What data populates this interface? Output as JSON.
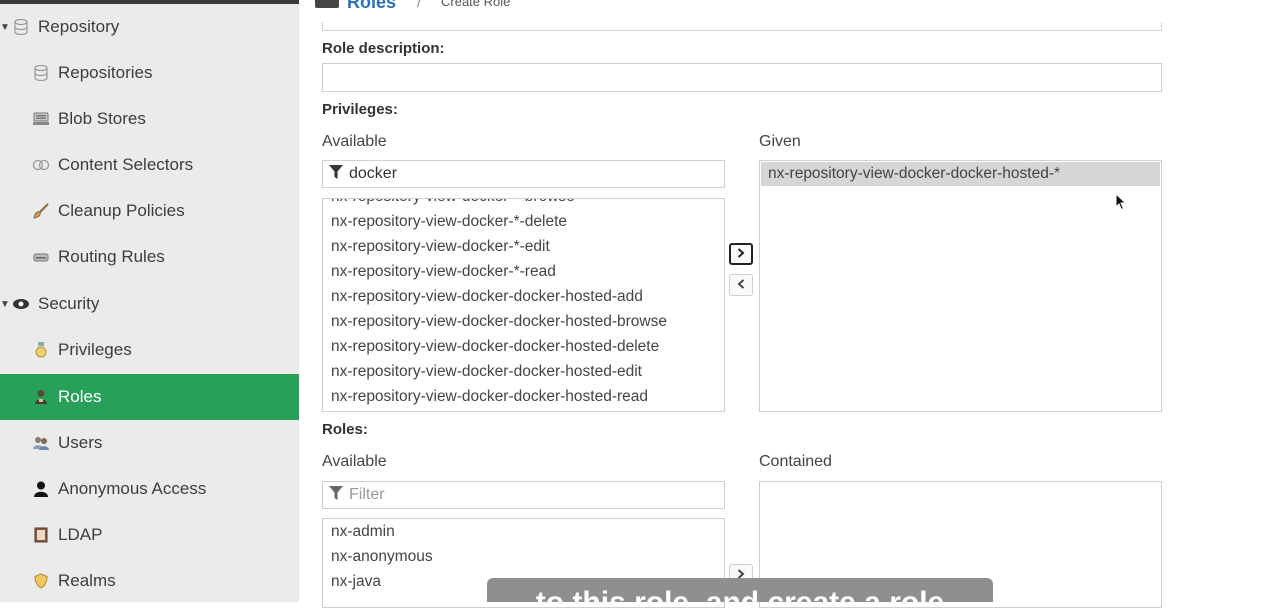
{
  "sidebar": {
    "repository_group": "Repository",
    "repository_items": [
      "Repositories",
      "Blob Stores",
      "Content Selectors",
      "Cleanup Policies",
      "Routing Rules"
    ],
    "security_group": "Security",
    "security_items": [
      "Privileges",
      "Roles",
      "Users",
      "Anonymous Access",
      "LDAP",
      "Realms"
    ],
    "active_item": "Roles",
    "icons": {
      "repository_group": "database-icon",
      "repositories": "database-icon",
      "blob_stores": "server-icon",
      "content_selectors": "selector-icon",
      "cleanup_policies": "brush-icon",
      "routing_rules": "router-icon",
      "security_group": "eye-icon",
      "privileges": "medal-icon",
      "roles": "role-badge-icon",
      "users": "users-icon",
      "anonymous_access": "person-icon",
      "ldap": "book-icon",
      "realms": "shield-icon"
    },
    "active_color": "#28a05a"
  },
  "breadcrumb": {
    "title": "Roles",
    "sub": "Create Role"
  },
  "form": {
    "role_description_label": "Role description:",
    "role_description_value": "",
    "privileges_label": "Privileges:",
    "privileges": {
      "available_label": "Available",
      "given_label": "Given",
      "filter_value": "docker",
      "available_items": [
        "nx-repository-view-docker-*-browse",
        "nx-repository-view-docker-*-delete",
        "nx-repository-view-docker-*-edit",
        "nx-repository-view-docker-*-read",
        "nx-repository-view-docker-docker-hosted-add",
        "nx-repository-view-docker-docker-hosted-browse",
        "nx-repository-view-docker-docker-hosted-delete",
        "nx-repository-view-docker-docker-hosted-edit",
        "nx-repository-view-docker-docker-hosted-read"
      ],
      "given_items": [
        "nx-repository-view-docker-docker-hosted-*"
      ],
      "add_button": "›",
      "remove_button": "‹"
    },
    "roles_label": "Roles:",
    "roles": {
      "available_label": "Available",
      "contained_label": "Contained",
      "filter_placeholder": "Filter",
      "available_items": [
        "nx-admin",
        "nx-anonymous",
        "nx-java"
      ],
      "add_button": "›"
    }
  },
  "caption": "to this role, and create a role"
}
